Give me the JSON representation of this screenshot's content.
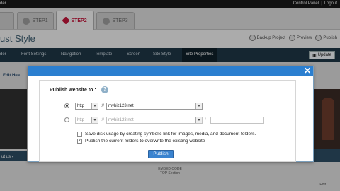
{
  "topbar": {
    "label": "der",
    "links": [
      "Control Panel",
      "Logout"
    ]
  },
  "steps": [
    {
      "label": "",
      "active": false
    },
    {
      "label": "STEP1",
      "active": false
    },
    {
      "label": "STEP2",
      "active": true
    },
    {
      "label": "STEP3",
      "active": false
    }
  ],
  "header": {
    "site_title": "ust Style",
    "actions": [
      "Backup Project",
      "Preview",
      "Publish"
    ]
  },
  "nav": {
    "items": [
      "der",
      "Font Settings",
      "Navigation",
      "Template",
      "Screen",
      "Site Style",
      "Site Properties"
    ],
    "active": "Site Properties",
    "update_label": "Update"
  },
  "subbar": {
    "edit_link": "Edit Hea"
  },
  "canvas": {
    "left_strip": "ut us ▾",
    "embed_line1": "EMBED CODE",
    "embed_line2": "TOP Section",
    "edit_small": "Edit"
  },
  "modal": {
    "close_glyph": "✕",
    "publish_to_label": "Publish website to :",
    "help_glyph": "?",
    "row1": {
      "protocol": "http",
      "separator": "://",
      "domain": "mybiz123.net",
      "selected": true
    },
    "row2": {
      "protocol": "http",
      "separator": "://",
      "domain": "mybiz123.net",
      "path": "",
      "selected": false
    },
    "options": [
      {
        "label": "Save disk usage by creating symbolic link for images, media, and document folders.",
        "checked": false
      },
      {
        "label": "Publish the current folders to overwrite the existing website",
        "checked": true
      }
    ],
    "publish_button": "Publish"
  }
}
